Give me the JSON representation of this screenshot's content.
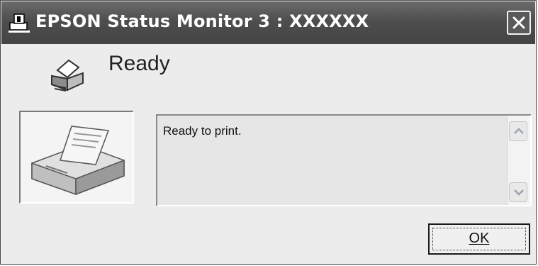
{
  "window": {
    "title": "EPSON Status Monitor 3 : XXXXXX",
    "title_icon": "status-monitor-icon",
    "close_icon": "close-icon"
  },
  "status": {
    "icon": "printer-icon",
    "text": "Ready"
  },
  "printer_image": "printer-illustration",
  "message": {
    "text": "Ready to print.",
    "scroll_up_icon": "chevron-up-icon",
    "scroll_down_icon": "chevron-down-icon"
  },
  "buttons": {
    "ok_label": "OK",
    "ok_mnemonic": "O"
  }
}
